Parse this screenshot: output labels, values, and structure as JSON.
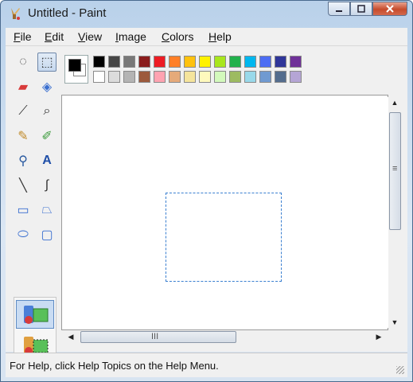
{
  "window": {
    "title": "Untitled - Paint"
  },
  "menu": [
    {
      "label": "File",
      "acc": "F",
      "rest": "ile"
    },
    {
      "label": "Edit",
      "acc": "E",
      "rest": "dit"
    },
    {
      "label": "View",
      "acc": "V",
      "rest": "iew"
    },
    {
      "label": "Image",
      "acc": "I",
      "rest": "mage"
    },
    {
      "label": "Colors",
      "acc": "C",
      "rest": "olors"
    },
    {
      "label": "Help",
      "acc": "H",
      "rest": "elp"
    }
  ],
  "tools": [
    {
      "name": "free-form-select-icon",
      "glyph": "◌"
    },
    {
      "name": "select-icon",
      "glyph": "⬚",
      "selected": true
    },
    {
      "name": "eraser-icon",
      "glyph": "▰",
      "color": "#d83a3a"
    },
    {
      "name": "fill-bucket-icon",
      "glyph": "◈",
      "color": "#3a6fd0"
    },
    {
      "name": "color-picker-icon",
      "glyph": "⟋",
      "color": "#333"
    },
    {
      "name": "magnifier-icon",
      "glyph": "⌕",
      "color": "#333"
    },
    {
      "name": "pencil-icon",
      "glyph": "✎",
      "color": "#c08a2a"
    },
    {
      "name": "brush-icon",
      "glyph": "✐",
      "color": "#3a9a3a"
    },
    {
      "name": "airbrush-icon",
      "glyph": "⚲",
      "color": "#2a5aa0"
    },
    {
      "name": "text-icon",
      "glyph": "A",
      "color": "#1f4fa8"
    },
    {
      "name": "line-icon",
      "glyph": "╲",
      "color": "#333"
    },
    {
      "name": "curve-icon",
      "glyph": "∫",
      "color": "#333"
    },
    {
      "name": "rectangle-icon",
      "glyph": "▭",
      "color": "#3a6fd0"
    },
    {
      "name": "polygon-icon",
      "glyph": "⏢",
      "color": "#3a6fd0"
    },
    {
      "name": "ellipse-icon",
      "glyph": "⬭",
      "color": "#3a6fd0"
    },
    {
      "name": "rounded-rectangle-icon",
      "glyph": "▢",
      "color": "#3a6fd0"
    }
  ],
  "palette": {
    "foreground": "#000000",
    "background": "#ffffff",
    "row1": [
      "#000000",
      "#464646",
      "#787878",
      "#8a1c1c",
      "#ed1c24",
      "#ff7f27",
      "#ffc20e",
      "#fff200",
      "#a8e61d",
      "#22b14c",
      "#00b7ef",
      "#4d6df3",
      "#2f3699",
      "#6f3198"
    ],
    "row2": [
      "#ffffff",
      "#dcdcdc",
      "#b4b4b4",
      "#9c5a3c",
      "#ffa3b1",
      "#e5aa7a",
      "#f5e49c",
      "#fff9bd",
      "#d3f9bc",
      "#9dbb61",
      "#99d9ea",
      "#709ad1",
      "#546d8e",
      "#b5a5d5"
    ]
  },
  "status": {
    "help_text": "For Help, click Help Topics on the Help Menu."
  },
  "scrollbar": {
    "grip": "III",
    "vgrip": "≡"
  }
}
